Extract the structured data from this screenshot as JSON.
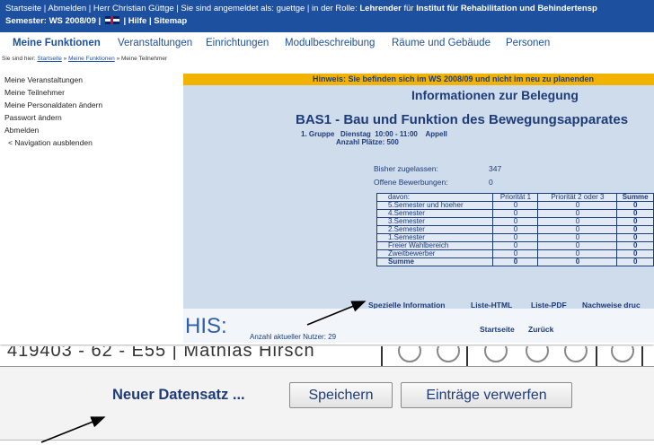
{
  "top": {
    "startseite": "Startseite",
    "abmelden": "Abmelden",
    "greeting": "Herr Christian Güttge",
    "logged_in_label": "Sie sind angemeldet als:",
    "username": "guettge",
    "role_label": "in der Rolle:",
    "role": "Lehrender",
    "role_for": "für",
    "institute": "Institut für Rehabilitation und Behindertensp",
    "semester": "Semester: WS 2008/09",
    "hilfe": "Hilfe",
    "sitemap": "Sitemap"
  },
  "nav": {
    "meine_funktionen": "Meine Funktionen",
    "veranstaltungen": "Veranstaltungen",
    "einrichtungen": "Einrichtungen",
    "modulbeschreibung": "Modulbeschreibung",
    "raeume": "Räume und Gebäude",
    "personen": "Personen"
  },
  "breadcrumb": {
    "prefix": "Sie sind hier:",
    "startseite": "Startseite",
    "meine_funktionen": "Meine Funktionen",
    "current": "Meine Teilnehmer"
  },
  "sidebar": {
    "items": [
      "Meine Veranstaltungen",
      "Meine Teilnehmer",
      "Meine Personaldaten ändern",
      "Passwort ändern",
      "Abmelden",
      "< Navigation ausblenden"
    ]
  },
  "main": {
    "hint": "Hinweis: Sie befinden sich im WS 2008/09 und nicht im neu zu planenden",
    "title": "Informationen zur Belegung",
    "course": "BAS1 - Bau und Funktion des Bewegungsapparates",
    "group": "1. Gruppe",
    "day": "Dienstag",
    "time": "10:00  -  11:00",
    "lecturer": "Appell",
    "places": "Anzahl Plätze: 500",
    "admitted_label": "Bisher zugelassen:",
    "admitted_value": "347",
    "open_label": "Offene Bewerbungen:",
    "open_value": "0",
    "table": {
      "headers": [
        "davon:",
        "Priorität 1",
        "Priorität 2 oder 3",
        "Summe"
      ],
      "rows": [
        [
          "5.Semester und hoeher",
          "0",
          "0",
          "0"
        ],
        [
          "4.Semester",
          "0",
          "0",
          "0"
        ],
        [
          "3.Semester",
          "0",
          "0",
          "0"
        ],
        [
          "2.Semester",
          "0",
          "0",
          "0"
        ],
        [
          "1.Semester",
          "0",
          "0",
          "0"
        ],
        [
          "Freier Wahlbereich",
          "0",
          "0",
          "0"
        ],
        [
          "Zweitbewerber",
          "0",
          "0",
          "0"
        ],
        [
          "Summe",
          "0",
          "0",
          "0"
        ]
      ]
    },
    "links": {
      "spezielle": "Spezielle Information",
      "liste_html": "Liste-HTML",
      "liste_pdf": "Liste-PDF",
      "nachweise": "Nachweise druc"
    },
    "footer": {
      "his": "HIS:",
      "users": "Anzahl aktueller Nutzer: 29",
      "startseite": "Startseite",
      "zurueck": "Zurück"
    }
  },
  "second": {
    "record_text": "419403  -  62  -  E55  |  Mathias  Hirsch",
    "new_record": "Neuer Datensatz ...",
    "save": "Speichern",
    "discard": "Einträge verwerfen"
  },
  "colors": {
    "topbar": "#1e50a0",
    "hint": "#f2b200",
    "content_bg": "#cfdcec",
    "text": "#1e3c78"
  }
}
